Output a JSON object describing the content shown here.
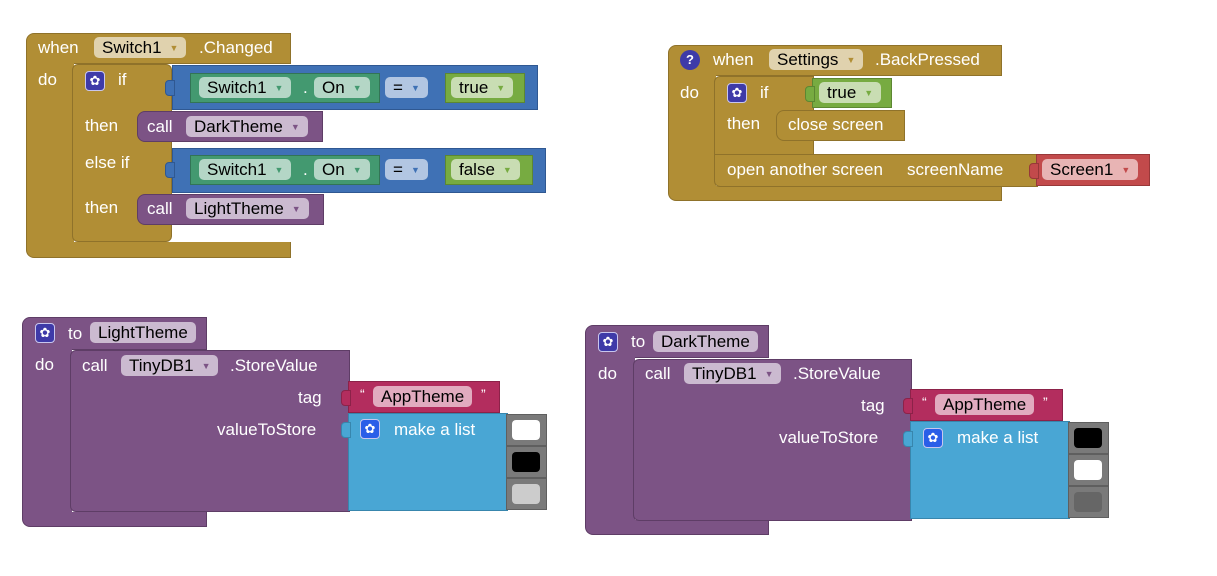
{
  "blocks": {
    "switch_changed": {
      "when_label": "when",
      "component": "Switch1",
      "event": ".Changed",
      "do_label": "do",
      "if_label": "if",
      "then_label": "then",
      "else_if_label": "else if",
      "conditions": [
        {
          "component": "Switch1",
          "dot": ".",
          "property": "On",
          "operator": "=",
          "value": "true",
          "then_call_label": "call",
          "then_procedure": "DarkTheme"
        },
        {
          "component": "Switch1",
          "dot": ".",
          "property": "On",
          "operator": "=",
          "value": "false",
          "then_call_label": "call",
          "then_procedure": "LightTheme"
        }
      ]
    },
    "settings_back": {
      "help_icon": "?",
      "when_label": "when",
      "component": "Settings",
      "event": ".BackPressed",
      "do_label": "do",
      "if_label": "if",
      "condition": "true",
      "then_label": "then",
      "then_action": "close screen",
      "next_action": "open another screen",
      "param_label": "screenName",
      "screen_value": "Screen1"
    },
    "light_theme": {
      "to_label": "to",
      "procedure": "LightTheme",
      "do_label": "do",
      "call_label": "call",
      "component": "TinyDB1",
      "method": ".StoreValue",
      "tag_label": "tag",
      "tag_value": "AppTheme",
      "value_label": "valueToStore",
      "list_label": "make a list",
      "colors": [
        "#ffffff",
        "#000000",
        "#cccccc"
      ]
    },
    "dark_theme": {
      "to_label": "to",
      "procedure": "DarkTheme",
      "do_label": "do",
      "call_label": "call",
      "component": "TinyDB1",
      "method": ".StoreValue",
      "tag_label": "tag",
      "tag_value": "AppTheme",
      "value_label": "valueToStore",
      "list_label": "make a list",
      "colors": [
        "#000000",
        "#ffffff",
        "#666666"
      ]
    }
  },
  "glyphs": {
    "gear": "✿",
    "dropdown": "▼",
    "open_quote": "“",
    "close_quote": "”"
  }
}
